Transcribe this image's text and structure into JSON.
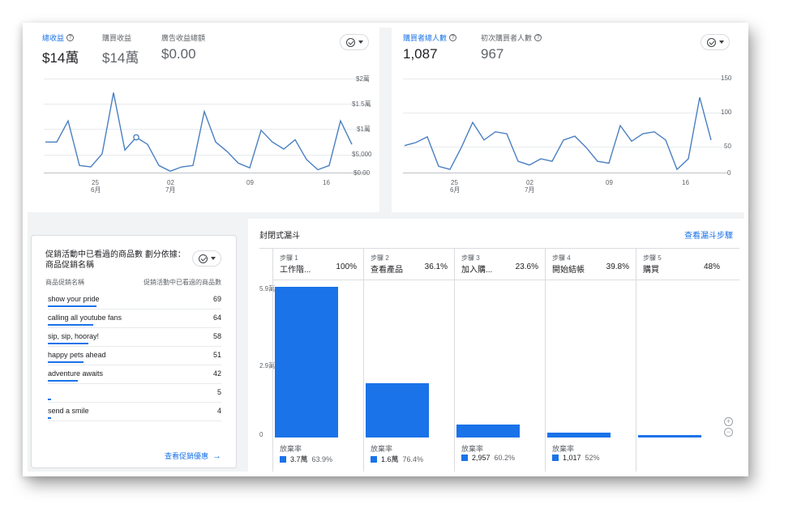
{
  "revenue_card": {
    "metrics": [
      {
        "label": "總收益",
        "value": "$14萬",
        "has_help": true
      },
      {
        "label": "購買收益",
        "value": "$14萬"
      },
      {
        "label": "廣告收益總額",
        "value": "$0.00"
      }
    ],
    "compare_icon": "check-circle-icon"
  },
  "purchasers_card": {
    "metrics": [
      {
        "label": "購買者總人數",
        "value": "1,087",
        "has_help": true
      },
      {
        "label": "初次購買者人數",
        "value": "967",
        "has_help": true
      }
    ],
    "compare_icon": "check-circle-icon"
  },
  "revenue_chart": {
    "type": "line",
    "y_ticks": [
      "$2萬",
      "$1.5萬",
      "$1萬",
      "$5,000",
      "$0.00"
    ],
    "x_ticks": [
      {
        "day": "25",
        "month": "6月"
      },
      {
        "day": "02",
        "month": "7月"
      },
      {
        "day": "09",
        "month": ""
      },
      {
        "day": "16",
        "month": ""
      }
    ],
    "color": "#4a7fc1",
    "peak_marker_index": 8
  },
  "purchasers_chart": {
    "type": "line",
    "y_ticks": [
      "150",
      "100",
      "50",
      "0"
    ],
    "x_ticks": [
      {
        "day": "25",
        "month": "6月"
      },
      {
        "day": "02",
        "month": "7月"
      },
      {
        "day": "09",
        "month": ""
      },
      {
        "day": "16",
        "month": ""
      }
    ],
    "color": "#4a7fc1"
  },
  "chart_data": [
    {
      "type": "line",
      "title": "",
      "yticks": [
        "$2萬",
        "$1.5萬",
        "$1萬",
        "$5,000",
        "$0.00"
      ],
      "xticks": [
        "25 6月",
        "02 7月",
        "09",
        "16"
      ],
      "ylim": [
        0,
        20000
      ],
      "values": [
        6500,
        6500,
        11000,
        1500,
        1200,
        4000,
        17000,
        4800,
        7500,
        6000,
        1500,
        300,
        1200,
        1500,
        13000,
        6500,
        4500,
        2000,
        1000,
        9000,
        6500,
        5000,
        7000,
        2800,
        600,
        1500,
        11000,
        6000
      ]
    },
    {
      "type": "line",
      "title": "",
      "yticks": [
        "150",
        "100",
        "50",
        "0"
      ],
      "xticks": [
        "25 6月",
        "02 7月",
        "09",
        "16"
      ],
      "ylim": [
        0,
        150
      ],
      "values": [
        43,
        48,
        57,
        10,
        5,
        40,
        80,
        52,
        65,
        62,
        18,
        12,
        22,
        18,
        52,
        58,
        40,
        18,
        15,
        75,
        50,
        62,
        65,
        52,
        5,
        22,
        120,
        52
      ]
    },
    {
      "type": "bar",
      "title": "封閉式漏斗",
      "categories": [
        "工作階...",
        "查看產品",
        "加入購...",
        "開始結帳",
        "購買"
      ],
      "values": [
        58000,
        21000,
        5000,
        1900,
        900
      ],
      "ylim": [
        0,
        59000
      ]
    }
  ],
  "promo_card": {
    "title_line1": "促銷活動中已看過的商品數 劃分依據：",
    "title_line2": "商品促銷名稱",
    "col_name": "商品促銷名稱",
    "col_value": "促銷活動中已看過的商品數",
    "rows": [
      {
        "name": "show your pride",
        "value": "69",
        "bar": 1.0
      },
      {
        "name": "calling all youtube fans",
        "value": "64",
        "bar": 0.93
      },
      {
        "name": "sip, sip, hooray!",
        "value": "58",
        "bar": 0.84
      },
      {
        "name": "happy pets ahead",
        "value": "51",
        "bar": 0.74
      },
      {
        "name": "adventure awaits",
        "value": "42",
        "bar": 0.61
      },
      {
        "name": "",
        "value": "5",
        "bar": 0.07
      },
      {
        "name": "send a smile",
        "value": "4",
        "bar": 0.06
      }
    ],
    "link": "查看促銷優惠",
    "link_arrow": "→"
  },
  "funnel": {
    "title": "封閉式漏斗",
    "link": "查看漏斗步驟",
    "y_ticks": [
      "5.9萬",
      "2.9萬",
      "0"
    ],
    "steps": [
      {
        "sub": "步驟 1",
        "name": "工作階...",
        "pct": "100%",
        "abandon_label": "放棄率",
        "abandon_value": "3.7萬",
        "abandon_pct": "63.9%"
      },
      {
        "sub": "步驟 2",
        "name": "查看產品",
        "pct": "36.1%",
        "abandon_label": "放棄率",
        "abandon_value": "1.6萬",
        "abandon_pct": "76.4%"
      },
      {
        "sub": "步驟 3",
        "name": "加入購...",
        "pct": "23.6%",
        "abandon_label": "放棄率",
        "abandon_value": "2,957",
        "abandon_pct": "60.2%"
      },
      {
        "sub": "步驟 4",
        "name": "開始結帳",
        "pct": "39.8%",
        "abandon_label": "放棄率",
        "abandon_value": "1,017",
        "abandon_pct": "52%"
      },
      {
        "sub": "步驟 5",
        "name": "購買",
        "pct": "48%"
      }
    ],
    "bar_color": "#1a73e8",
    "zoom_in": "+",
    "zoom_out": "−"
  }
}
